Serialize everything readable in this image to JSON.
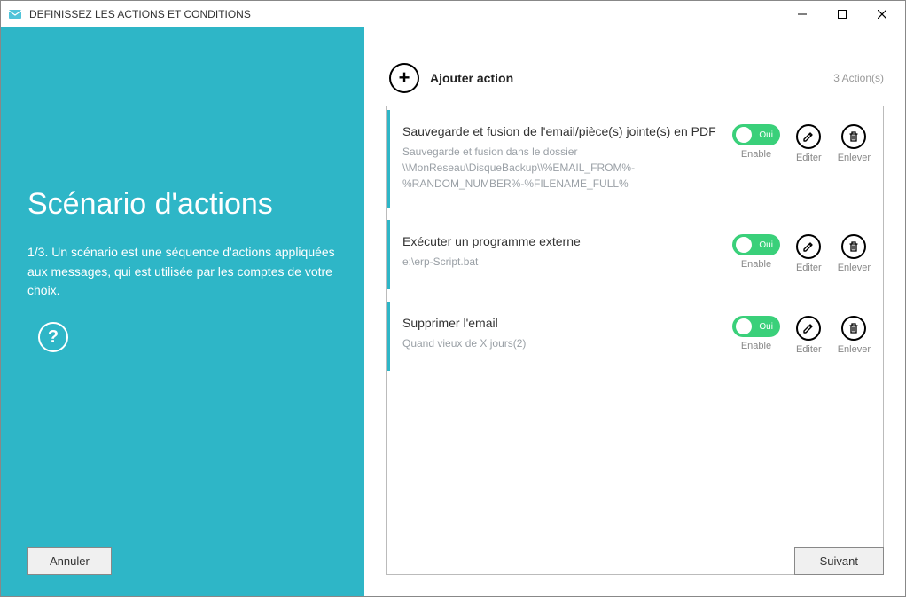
{
  "window_title": "DEFINISSEZ LES ACTIONS ET CONDITIONS",
  "sidebar": {
    "heading": "Scénario d'actions",
    "description": "1/3. Un scénario est une séquence d'actions appliquées aux messages, qui est utilisée par les comptes de votre choix.",
    "help_symbol": "?",
    "cancel_label": "Annuler"
  },
  "main": {
    "add_label": "Ajouter action",
    "count_text": "3  Action(s)",
    "toggle_state_label": "Oui",
    "control_labels": {
      "enable": "Enable",
      "edit": "Editer",
      "remove": "Enlever"
    },
    "actions": [
      {
        "title": "Sauvegarde et fusion de l'email/pièce(s) jointe(s) en PDF",
        "subtitle": "Sauvegarde et fusion dans le dossier \\\\MonReseau\\DisqueBackup\\\\%EMAIL_FROM%-%RANDOM_NUMBER%-%FILENAME_FULL%"
      },
      {
        "title": "Exécuter un programme externe",
        "subtitle": "e:\\erp-Script.bat"
      },
      {
        "title": "Supprimer l'email",
        "subtitle": "Quand vieux de X jours(2)"
      }
    ],
    "next_label": "Suivant"
  }
}
